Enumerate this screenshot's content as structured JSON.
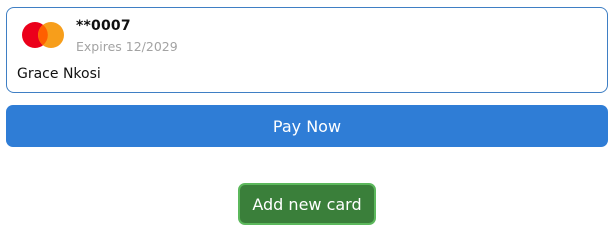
{
  "saved_card": {
    "brand_icon": "mastercard-logo-icon",
    "masked_number": "**0007",
    "expiry": "Expires 12/2029",
    "cardholder": "Grace Nkosi",
    "border_color": "#3f7fc4"
  },
  "actions": {
    "pay_now_label": "Pay Now",
    "add_card_label": "Add new card"
  },
  "colors": {
    "primary": "#2f7dd6",
    "success": "#3a7f3a",
    "success_border": "#5cb85c",
    "mastercard_red": "#eb001b",
    "mastercard_orange": "#f79e1b",
    "mastercard_overlap": "#ff5f00",
    "muted_text": "#a3a3a3"
  }
}
